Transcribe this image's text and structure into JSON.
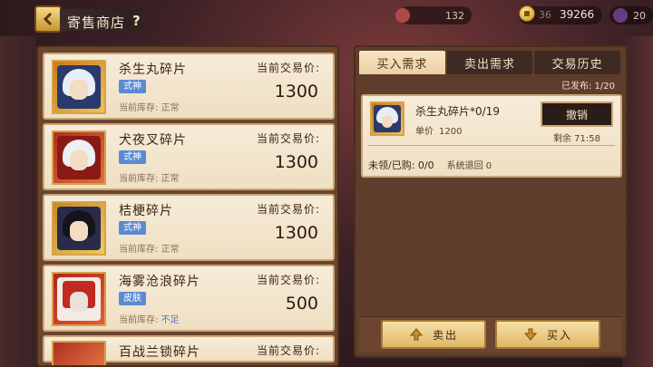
{
  "header": {
    "title": "寄售商店",
    "help_label": "?",
    "resources": {
      "res1_value": "132",
      "small_count": "36",
      "gold_value": "39266",
      "res3_value": "20"
    }
  },
  "shop_items": [
    {
      "name": "杀生丸碎片",
      "tag": "式神",
      "tag_color": "#5a8ad4",
      "stock_label": "当前库存:",
      "stock_value": "正常",
      "price_label": "当前交易价:",
      "price": "1300"
    },
    {
      "name": "犬夜叉碎片",
      "tag": "式神",
      "tag_color": "#5a8ad4",
      "stock_label": "当前库存:",
      "stock_value": "正常",
      "price_label": "当前交易价:",
      "price": "1300"
    },
    {
      "name": "桔梗碎片",
      "tag": "式神",
      "tag_color": "#5a8ad4",
      "stock_label": "当前库存:",
      "stock_value": "正常",
      "price_label": "当前交易价:",
      "price": "1300"
    },
    {
      "name": "海雾沧浪碎片",
      "tag": "皮肤",
      "tag_color": "#5a8ad4",
      "stock_label": "当前库存:",
      "stock_value": "不足",
      "price_label": "当前交易价:",
      "price": "500"
    },
    {
      "name": "百战兰锁碎片",
      "price_label": "当前交易价:"
    }
  ],
  "tabs": [
    {
      "label": "买入需求",
      "active": true
    },
    {
      "label": "卖出需求",
      "active": false
    },
    {
      "label": "交易历史",
      "active": false
    }
  ],
  "published": "已发布: 1/20",
  "request": {
    "name": "杀生丸碎片*0/19",
    "price_label": "单价",
    "price_value": "1200",
    "cancel_label": "撤销",
    "remaining": "剩余 71:58",
    "unclaimed": "未领/已购: 0/0",
    "system_return": "系统退回 0"
  },
  "actions": {
    "sell_label": "卖出",
    "buy_label": "买入"
  }
}
